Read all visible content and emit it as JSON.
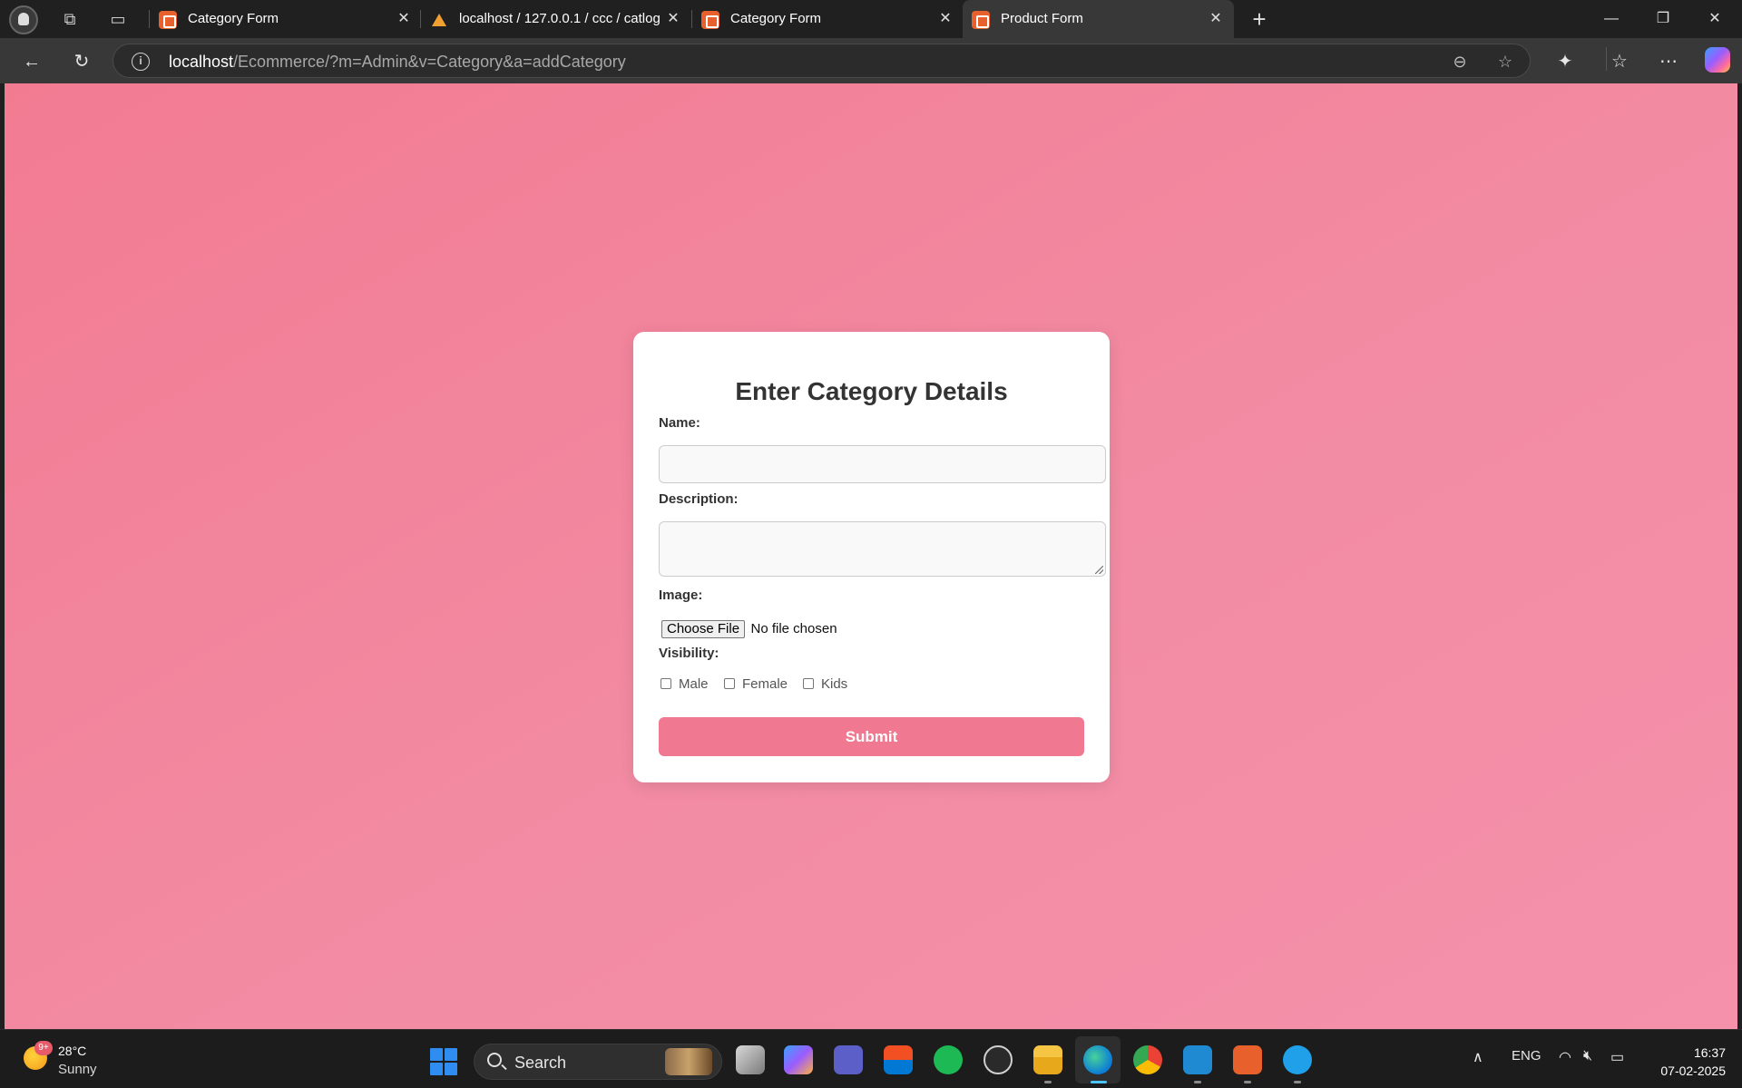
{
  "browser": {
    "tabs": [
      {
        "title": "Category Form",
        "favicon": "xampp-icon",
        "active": false
      },
      {
        "title": "localhost / 127.0.0.1 / ccc / catlog",
        "favicon": "phpmyadmin-icon",
        "active": false
      },
      {
        "title": "Category Form",
        "favicon": "xampp-icon",
        "active": false
      },
      {
        "title": "Product Form",
        "favicon": "xampp-icon",
        "active": true
      }
    ],
    "url_host": "localhost",
    "url_path": "/Ecommerce/?m=Admin&v=Category&a=addCategory"
  },
  "form": {
    "heading": "Enter Category Details",
    "name_label": "Name:",
    "name_value": "",
    "description_label": "Description:",
    "description_value": "",
    "image_label": "Image:",
    "file_button": "Choose File",
    "file_status": "No file chosen",
    "visibility_label": "Visibility:",
    "visibility_options": [
      {
        "label": "Male",
        "checked": false
      },
      {
        "label": "Female",
        "checked": false
      },
      {
        "label": "Kids",
        "checked": false
      }
    ],
    "submit_label": "Submit"
  },
  "taskbar": {
    "weather_badge": "9+",
    "weather_temp": "28°C",
    "weather_condition": "Sunny",
    "search_placeholder": "Search",
    "language": "ENG",
    "time": "16:37",
    "date": "07-02-2025"
  },
  "colors": {
    "page_background": "#f28199",
    "card_background": "#ffffff",
    "submit_button": "#f07890",
    "heading_text": "#333333"
  }
}
